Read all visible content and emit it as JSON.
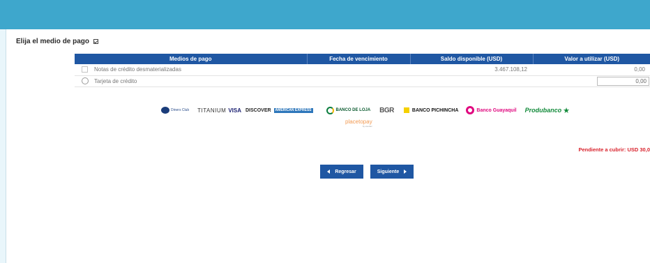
{
  "heading": "Elija el medio de pago",
  "table": {
    "headers": [
      "Medios de pago",
      "Fecha de vencimiento",
      "Saldo disponible (USD)",
      "Valor a utilizar (USD)"
    ],
    "rows": [
      {
        "label": "Notas de crédito desmaterializadas",
        "date": "",
        "balance": "3.467.108,12",
        "value": "0,00"
      },
      {
        "label": "Tarjeta de crédito",
        "date": "",
        "balance": "",
        "value": "0,00"
      }
    ]
  },
  "logos": {
    "diners": "Diners Club",
    "titanium": "TITANIUM",
    "visa": "VISA",
    "discover": "DISCOVER",
    "amex": "AMERICAN EXPRESS",
    "loja": "BANCO DE LOJA",
    "bgr": "BGR",
    "pichincha": "BANCO PICHINCHA",
    "guayaquil": "Banco Guayaquil",
    "produbanco": "Produbanco",
    "placetopay": "placetopay",
    "placetopay_sub": "by evertec"
  },
  "pending": "Pendiente a cubrir: USD 30,0",
  "buttons": {
    "back": "Regresar",
    "next": "Siguiente"
  },
  "colors": {
    "topbar": "#3ea7cc",
    "header": "#1f57a3",
    "pending": "#d9232d"
  }
}
